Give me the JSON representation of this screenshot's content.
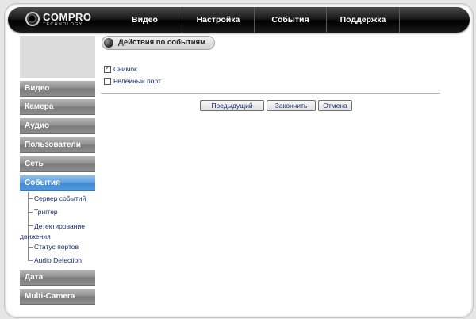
{
  "brand": {
    "name": "COMPRO",
    "tagline": "TECHNOLOGY"
  },
  "top_nav": [
    {
      "label": "Видео"
    },
    {
      "label": "Настройка"
    },
    {
      "label": "События"
    },
    {
      "label": "Поддержка"
    }
  ],
  "sidebar": {
    "items": [
      {
        "label": "Видео"
      },
      {
        "label": "Камера"
      },
      {
        "label": "Аудио"
      },
      {
        "label": "Пользователи"
      },
      {
        "label": "Сеть"
      },
      {
        "label": "События"
      },
      {
        "label": "Дата"
      },
      {
        "label": "Multi-Camera"
      }
    ],
    "active_item": "События",
    "sub_items": [
      {
        "label": "Сервер событий"
      },
      {
        "label": "Триггер"
      },
      {
        "label": "Детектирование движения"
      },
      {
        "label": "Статус портов"
      },
      {
        "label": "Audio Detection"
      }
    ]
  },
  "main": {
    "section_title": "Действия по событиям",
    "options": [
      {
        "label": "Снимок",
        "checked": true
      },
      {
        "label": "Релейный порт",
        "checked": false
      }
    ],
    "buttons": {
      "prev": "Предыдущий",
      "finish": "Закончить",
      "cancel": "Отмена"
    }
  },
  "colors": {
    "active_sidebar": "#4f95db",
    "sidebar_gray": "#8f8f8f",
    "link_text": "#1b2f66",
    "topbar": "#111111"
  },
  "icons": {
    "logo": "compro-ring-logo",
    "section": "dark-sphere-icon",
    "checkmark": "check-icon"
  }
}
